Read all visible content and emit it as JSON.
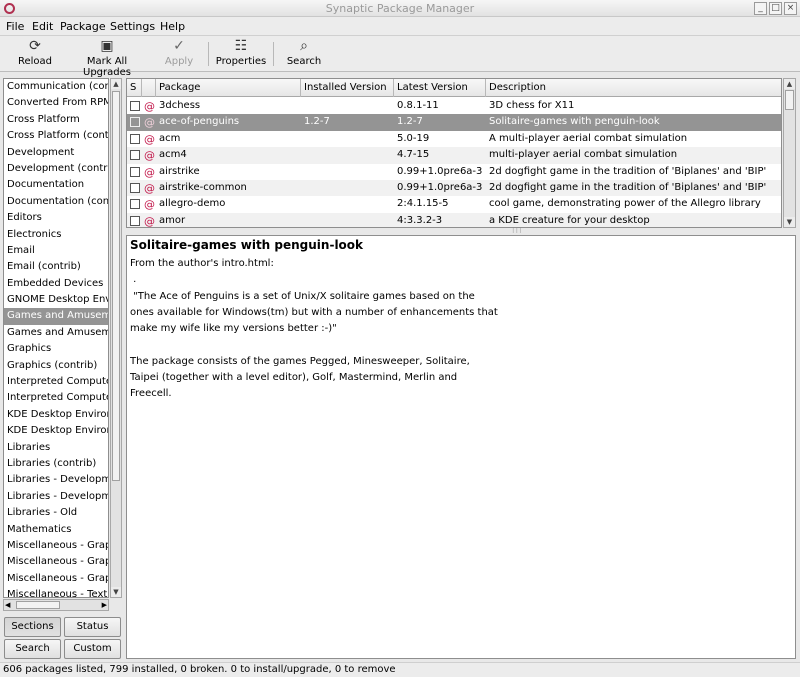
{
  "window": {
    "title": "Synaptic Package Manager",
    "minimize": "_",
    "maximize": "□",
    "close": "×"
  },
  "menu": [
    "File",
    "Edit",
    "Package",
    "Settings",
    "Help"
  ],
  "toolbar": {
    "reload": "Reload",
    "mark_all": "Mark All Upgrades",
    "apply": "Apply",
    "properties": "Properties",
    "search": "Search"
  },
  "sidebar": {
    "items": [
      "Communication (contrib)",
      "Converted From RPM by Alien",
      "Cross Platform",
      "Cross Platform (contrib)",
      "Development",
      "Development (contrib)",
      "Documentation",
      "Documentation (contrib)",
      "Editors",
      "Electronics",
      "Email",
      "Email (contrib)",
      "Embedded Devices",
      "GNOME Desktop Environment",
      "Games and Amusements",
      "Games and Amusements (contrib)",
      "Graphics",
      "Graphics (contrib)",
      "Interpreted Computer Languages",
      "Interpreted Computer Languages (contrib)",
      "KDE Desktop Environment",
      "KDE Desktop Environment (contrib)",
      "Libraries",
      "Libraries (contrib)",
      "Libraries - Development",
      "Libraries - Development (contrib)",
      "Libraries - Old",
      "Mathematics",
      "Miscellaneous - Graphical",
      "Miscellaneous - Graphical (contrib)",
      "Miscellaneous - Graphical (non-free)",
      "Miscellaneous - Text Based"
    ],
    "selected_index": 14,
    "buttons": {
      "sections": "Sections",
      "status": "Status",
      "search": "Search",
      "custom": "Custom"
    }
  },
  "table": {
    "headers": {
      "s": "S",
      "package": "Package",
      "installed": "Installed Version",
      "latest": "Latest Version",
      "description": "Description"
    },
    "rows": [
      {
        "package": "3dchess",
        "installed": "",
        "latest": "0.8.1-11",
        "description": "3D chess for X11"
      },
      {
        "package": "ace-of-penguins",
        "installed": "1.2-7",
        "latest": "1.2-7",
        "description": "Solitaire-games with penguin-look"
      },
      {
        "package": "acm",
        "installed": "",
        "latest": "5.0-19",
        "description": "A multi-player aerial combat simulation"
      },
      {
        "package": "acm4",
        "installed": "",
        "latest": "4.7-15",
        "description": "multi-player aerial combat simulation"
      },
      {
        "package": "airstrike",
        "installed": "",
        "latest": "0.99+1.0pre6a-3",
        "description": "2d dogfight game in the tradition of 'Biplanes' and 'BIP'"
      },
      {
        "package": "airstrike-common",
        "installed": "",
        "latest": "0.99+1.0pre6a-3",
        "description": "2d dogfight game in the tradition of 'Biplanes' and 'BIP'"
      },
      {
        "package": "allegro-demo",
        "installed": "",
        "latest": "2:4.1.15-5",
        "description": "cool game, demonstrating power of the Allegro library"
      },
      {
        "package": "amor",
        "installed": "",
        "latest": "4:3.3.2-3",
        "description": "a KDE creature for your desktop"
      }
    ],
    "selected_index": 1
  },
  "description": {
    "title": "Solitaire-games with penguin-look",
    "lines": [
      "From the author's intro.html:",
      " .",
      " \"The Ace of Penguins is a set of Unix/X solitaire games based on the",
      "ones available for Windows(tm) but with a number of enhancements that",
      "make my wife like my versions better :-)\"",
      "",
      "The package consists of the games Pegged, Minesweeper, Solitaire,",
      "Taipei (together with a level editor), Golf, Mastermind, Merlin and",
      "Freecell."
    ]
  },
  "status": "606 packages listed, 799 installed, 0 broken. 0 to install/upgrade, 0 to remove"
}
